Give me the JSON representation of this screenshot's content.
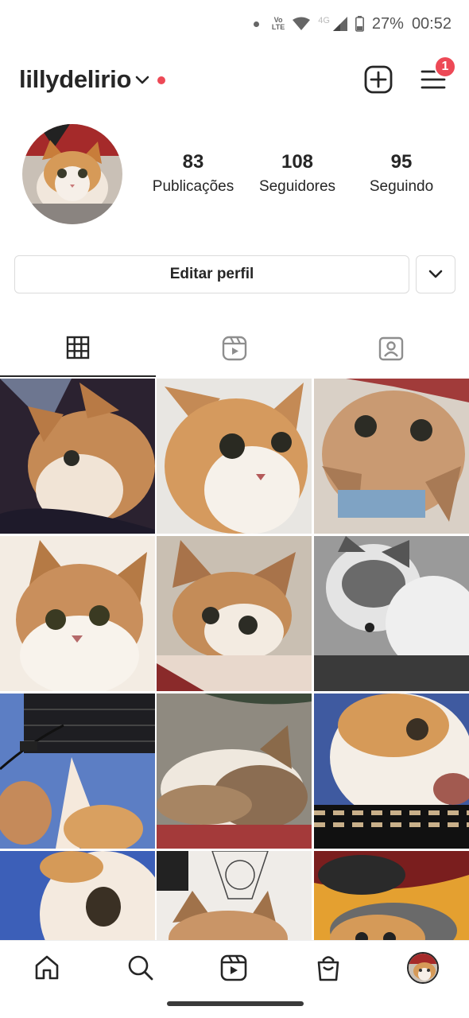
{
  "status_bar": {
    "volte_label": "Vo\nLTE",
    "network_label": "4G",
    "battery": "27%",
    "time": "00:52"
  },
  "header": {
    "username": "lillydelirio",
    "notification_count": "1",
    "accent_red": "#ed4956"
  },
  "profile": {
    "stats": [
      {
        "value": "83",
        "label": "Publicações"
      },
      {
        "value": "108",
        "label": "Seguidores"
      },
      {
        "value": "95",
        "label": "Seguindo"
      }
    ]
  },
  "actions": {
    "edit_profile_label": "Editar perfil"
  },
  "tabs": [
    {
      "icon": "grid-icon",
      "active": true
    },
    {
      "icon": "reels-icon",
      "active": false
    },
    {
      "icon": "tagged-icon",
      "active": false
    }
  ],
  "posts": [
    {
      "theme": "cat-dark"
    },
    {
      "theme": "cat-light"
    },
    {
      "theme": "cat-upside"
    },
    {
      "theme": "cat-closeup"
    },
    {
      "theme": "cat-blanket"
    },
    {
      "theme": "cat-bw"
    },
    {
      "theme": "cat-keyboard"
    },
    {
      "theme": "cat-sleeping"
    },
    {
      "theme": "cat-basket"
    },
    {
      "theme": "cat-eye"
    },
    {
      "theme": "cat-drawing"
    },
    {
      "theme": "cat-hat"
    }
  ],
  "bottom_nav": [
    {
      "icon": "home-icon"
    },
    {
      "icon": "search-icon"
    },
    {
      "icon": "reels-icon"
    },
    {
      "icon": "shop-icon"
    },
    {
      "icon": "profile-avatar"
    }
  ]
}
